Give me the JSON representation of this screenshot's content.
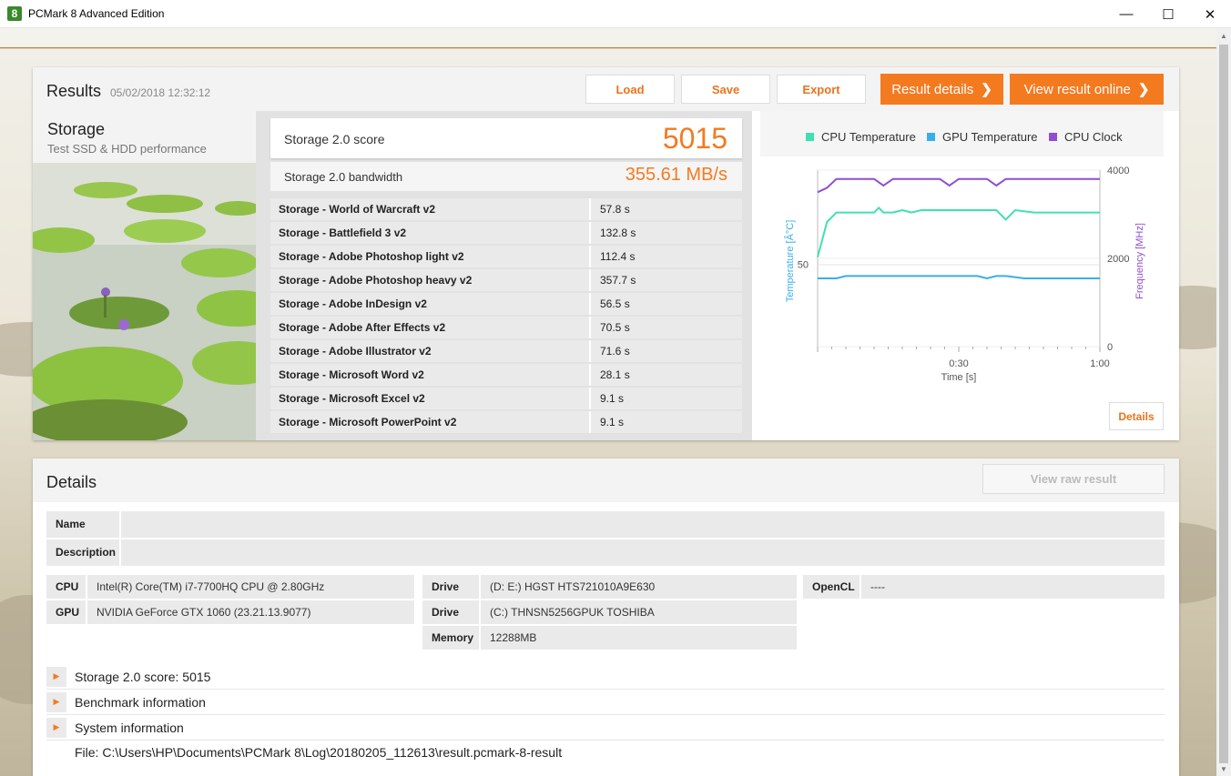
{
  "window": {
    "title": "PCMark 8 Advanced Edition",
    "controls": [
      "—",
      "☐",
      "✕"
    ]
  },
  "results": {
    "title": "Results",
    "date": "05/02/2018 12:32:12",
    "buttons": {
      "load": "Load",
      "save": "Save",
      "export": "Export",
      "result_details": "Result details",
      "view_online": "View result online"
    },
    "benchmark": {
      "name": "Storage",
      "subtitle": "Test SSD & HDD performance"
    },
    "score": {
      "label": "Storage 2.0 score",
      "value": "5015"
    },
    "bandwidth": {
      "label": "Storage 2.0 bandwidth",
      "value": "355.61 MB/s"
    },
    "tests": [
      {
        "name": "Storage - World of Warcraft v2",
        "value": "57.8 s"
      },
      {
        "name": "Storage - Battlefield 3 v2",
        "value": "132.8 s"
      },
      {
        "name": "Storage - Adobe Photoshop light v2",
        "value": "112.4 s"
      },
      {
        "name": "Storage - Adobe Photoshop heavy v2",
        "value": "357.7 s"
      },
      {
        "name": "Storage - Adobe InDesign v2",
        "value": "56.5 s"
      },
      {
        "name": "Storage - Adobe After Effects v2",
        "value": "70.5 s"
      },
      {
        "name": "Storage - Adobe Illustrator v2",
        "value": "71.6 s"
      },
      {
        "name": "Storage - Microsoft Word v2",
        "value": "28.1 s"
      },
      {
        "name": "Storage - Microsoft Excel v2",
        "value": "9.1 s"
      },
      {
        "name": "Storage - Microsoft PowerPoint v2",
        "value": "9.1 s"
      }
    ],
    "details_button": "Details"
  },
  "colors": {
    "accent": "#f47a20",
    "cpu_temp": "#40e0b0",
    "gpu_temp": "#3aaee8",
    "cpu_clock": "#8e4fd0"
  },
  "chart_data": {
    "type": "line",
    "xlabel": "Time [s]",
    "ylabel_left": "Temperature [Â°C]",
    "ylabel_right": "Frequency [MHz]",
    "x_ticks": [
      "0:30",
      "1:00"
    ],
    "y_left_ticks": [
      "50"
    ],
    "y_right_ticks": [
      "4000",
      "2000",
      "0"
    ],
    "xlim": [
      0,
      60
    ],
    "ylim_left": [
      15,
      90
    ],
    "ylim_right": [
      0,
      4000
    ],
    "series": [
      {
        "name": "CPU Temperature",
        "axis": "left",
        "x": [
          0,
          2,
          4,
          8,
          12,
          13,
          14,
          16,
          18,
          20,
          22,
          24,
          28,
          32,
          36,
          38,
          40,
          42,
          46,
          50,
          54,
          58,
          60
        ],
        "values": [
          53,
          68,
          72,
          72,
          72,
          74,
          72,
          72,
          73,
          72,
          73,
          73,
          73,
          73,
          73,
          73,
          69,
          73,
          72,
          72,
          72,
          72,
          72
        ]
      },
      {
        "name": "GPU Temperature",
        "axis": "left",
        "x": [
          0,
          4,
          6,
          10,
          20,
          30,
          34,
          36,
          38,
          40,
          44,
          50,
          60
        ],
        "values": [
          44,
          44,
          45,
          45,
          45,
          45,
          45,
          44,
          45,
          45,
          44,
          44,
          44
        ]
      },
      {
        "name": "CPU Clock",
        "axis": "right",
        "x": [
          0,
          2,
          4,
          8,
          12,
          14,
          16,
          18,
          22,
          26,
          28,
          30,
          36,
          38,
          40,
          44,
          48,
          52,
          56,
          60
        ],
        "values": [
          3500,
          3600,
          3800,
          3800,
          3800,
          3650,
          3800,
          3800,
          3800,
          3800,
          3650,
          3800,
          3800,
          3650,
          3800,
          3800,
          3800,
          3800,
          3800,
          3800
        ]
      }
    ]
  },
  "details": {
    "title": "Details",
    "raw_button": "View raw result",
    "name_label": "Name",
    "description_label": "Description",
    "cpu": {
      "label": "CPU",
      "value": "Intel(R) Core(TM) i7-7700HQ CPU @ 2.80GHz"
    },
    "gpu": {
      "label": "GPU",
      "value": "NVIDIA GeForce GTX 1060 (23.21.13.9077)"
    },
    "drive1": {
      "label": "Drive",
      "value": "(D: E:) HGST HTS721010A9E630"
    },
    "drive2": {
      "label": "Drive",
      "value": "(C:) THNSN5256GPUK TOSHIBA"
    },
    "memory": {
      "label": "Memory",
      "value": "12288MB"
    },
    "opencl": {
      "label": "OpenCL",
      "value": "----"
    },
    "sections": [
      "Storage 2.0 score: 5015",
      "Benchmark information",
      "System information"
    ],
    "file": "File: C:\\Users\\HP\\Documents\\PCMark 8\\Log\\20180205_112613\\result.pcmark-8-result"
  }
}
